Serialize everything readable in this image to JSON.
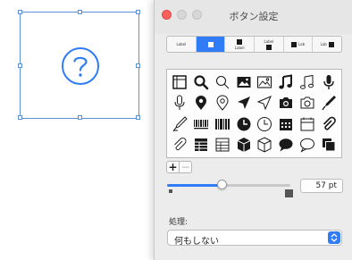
{
  "colors": {
    "accent": "#2f7cf6",
    "selection": "#5b8fd6",
    "close_light": "#fc605c",
    "icon": "#1a1a1a"
  },
  "canvas": {
    "selected_button_icon": "question-mark-circle-icon"
  },
  "panel": {
    "title": "ボタン設定",
    "layout_options": [
      {
        "name": "label-only",
        "text": "Label"
      },
      {
        "name": "icon-only"
      },
      {
        "name": "icon-above-label",
        "text": "Label"
      },
      {
        "name": "label-above-icon",
        "text": "Label"
      },
      {
        "name": "icon-left-label",
        "text": "Lab"
      },
      {
        "name": "label-left-icon",
        "text": "Lab"
      }
    ],
    "selected_layout_index": 1,
    "icons": [
      "frame-icon",
      "search-icon",
      "search-outline-icon",
      "image-icon",
      "image-outline-icon",
      "music-notes-icon",
      "music-notes-outline-icon",
      "microphone-icon",
      "microphone-outline-icon",
      "location-pin-icon",
      "location-pin-outline-icon",
      "navigation-arrow-icon",
      "navigation-arrow-outline-icon",
      "camera-icon",
      "camera-outline-icon",
      "pen-nib-icon",
      "pen-nib-outline-icon",
      "barcode-icon",
      "barcode-bold-icon",
      "clock-icon",
      "clock-outline-icon",
      "calendar-icon",
      "calendar-outline-icon",
      "paperclip-icon",
      "paperclip-outline-icon",
      "spreadsheet-icon",
      "spreadsheet-outline-icon",
      "box-icon",
      "box-outline-icon",
      "speech-bubble-icon",
      "speech-bubble-outline-icon",
      "copy-icon"
    ],
    "add_label": "+",
    "remove_label": "−",
    "size": {
      "value_text": "57 pt",
      "slider_fraction": 0.44
    },
    "action": {
      "label": "処理:",
      "value": "何もしない"
    }
  }
}
